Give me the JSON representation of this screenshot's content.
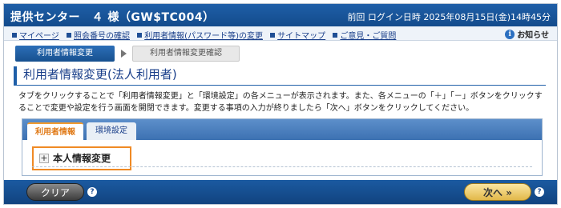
{
  "header": {
    "provider": "提供センター　４ 様（GW$TC004）",
    "last_login": "前回 ログイン日時 2025年08月15日(金)14時45分"
  },
  "nav": {
    "links": [
      "マイページ",
      "照会番号の確認",
      "利用者情報(パスワード等)の変更",
      "サイトマップ",
      "ご意見・ご質問"
    ],
    "notice": "お知らせ"
  },
  "steps": {
    "current": "利用者情報変更",
    "next": "利用者情報変更確認"
  },
  "title": "利用者情報変更(法人利用者)",
  "description": "タブをクリックすることで「利用者情報変更」と「環境設定」の各メニューが表示されます。また、各メニューの「＋」「－」ボタンをクリックすることで変更や設定を行う画面を開閉できます。変更する事項の入力が終りましたら「次へ」ボタンをクリックしてください。",
  "tabs": {
    "user_info": "利用者情報",
    "environment": "環境設定"
  },
  "section": {
    "label": "本人情報変更",
    "toggle": "+"
  },
  "footer": {
    "clear": "クリア",
    "next": "次へ »",
    "help": "?"
  }
}
